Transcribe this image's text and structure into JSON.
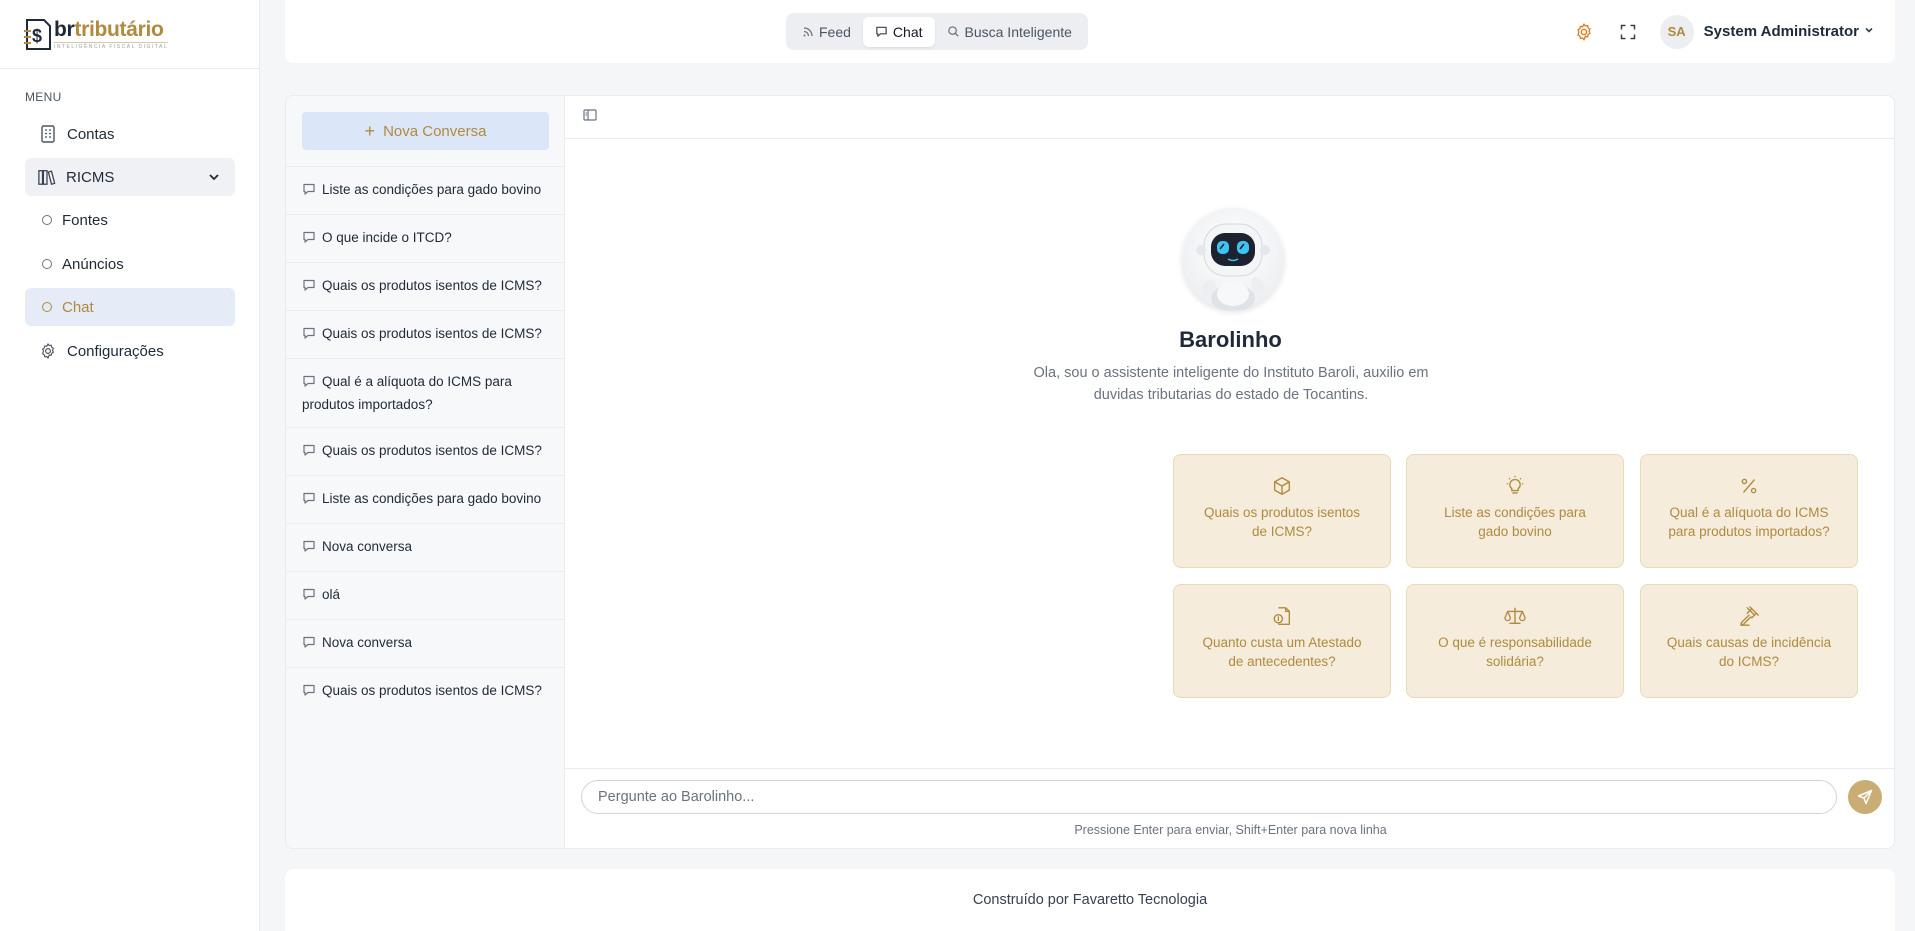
{
  "brand": {
    "word_prefix": "br",
    "word_main": "tributário",
    "tagline": "INTELIGÊNCIA FISCAL DIGITAL"
  },
  "sidebar": {
    "menu_title": "MENU",
    "items": [
      {
        "label": "Contas",
        "icon": "building-icon"
      },
      {
        "label": "RICMS",
        "icon": "books-icon",
        "expanded": true
      },
      {
        "label": "Fontes",
        "icon": "circle-icon"
      },
      {
        "label": "Anúncios",
        "icon": "circle-icon"
      },
      {
        "label": "Chat",
        "icon": "circle-icon",
        "active": true
      },
      {
        "label": "Configurações",
        "icon": "gear-icon"
      }
    ]
  },
  "topbar": {
    "tabs": [
      {
        "label": "Feed",
        "icon": "rss-icon"
      },
      {
        "label": "Chat",
        "icon": "message-icon",
        "active": true
      },
      {
        "label": "Busca Inteligente",
        "icon": "search-icon"
      }
    ],
    "user": {
      "initials": "SA",
      "name": "System Administrator"
    }
  },
  "conversations": {
    "new_label": "Nova Conversa",
    "items": [
      "Liste as condições para gado bovino",
      "O que incide o ITCD?",
      "Quais os produtos isentos de ICMS?",
      "Quais os produtos isentos de ICMS?",
      "Qual é a alíquota do ICMS para produtos importados?",
      "Quais os produtos isentos de ICMS?",
      "Liste as condições para gado bovino",
      "Nova conversa",
      "olá",
      "Nova conversa",
      "Quais os produtos isentos de ICMS?"
    ]
  },
  "chat": {
    "bot_name": "Barolinho",
    "bot_description": "Ola, sou o assistente inteligente do Instituto Baroli, auxilio em duvidas tributarias do estado de Tocantins.",
    "suggestions": [
      {
        "text": "Quais os produtos isentos de ICMS?",
        "icon": "package-icon"
      },
      {
        "text": "Liste as condições para gado bovino",
        "icon": "lightbulb-icon"
      },
      {
        "text": "Qual é a alíquota do ICMS para produtos importados?",
        "icon": "percent-icon"
      },
      {
        "text": "Quanto custa um Atestado de antecedentes?",
        "icon": "document-money-icon"
      },
      {
        "text": "O que é responsabilidade solidária?",
        "icon": "scale-icon"
      },
      {
        "text": "Quais causas de incidência do ICMS?",
        "icon": "gavel-icon"
      }
    ],
    "input_placeholder": "Pergunte ao Barolinho...",
    "hint": "Pressione Enter para enviar, Shift+Enter para nova linha"
  },
  "footer": {
    "text": "Construído por Favaretto Tecnologia"
  },
  "colors": {
    "accent": "#b08a3e",
    "suggestion_bg": "#f5ecdc",
    "active_bg": "#e5ebf7"
  }
}
